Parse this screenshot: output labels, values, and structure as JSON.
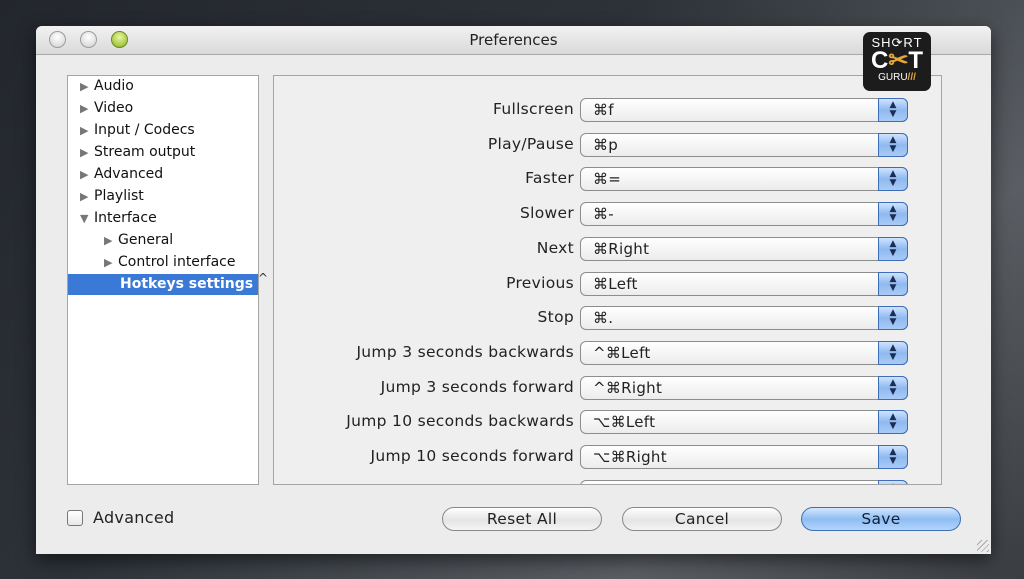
{
  "window": {
    "title": "Preferences"
  },
  "sidebar": {
    "items": [
      {
        "label": "Audio",
        "expanded": false,
        "level": 0
      },
      {
        "label": "Video",
        "expanded": false,
        "level": 0
      },
      {
        "label": "Input / Codecs",
        "expanded": false,
        "level": 0
      },
      {
        "label": "Stream output",
        "expanded": false,
        "level": 0
      },
      {
        "label": "Advanced",
        "expanded": false,
        "level": 0
      },
      {
        "label": "Playlist",
        "expanded": false,
        "level": 0
      },
      {
        "label": "Interface",
        "expanded": true,
        "level": 0
      },
      {
        "label": "General",
        "expanded": false,
        "level": 1
      },
      {
        "label": "Control interface",
        "expanded": false,
        "level": 1
      },
      {
        "label": "Hotkeys settings",
        "selected": true,
        "level": 1
      }
    ]
  },
  "hotkeys": [
    {
      "label": "Fullscreen",
      "value": "⌘f"
    },
    {
      "label": "Play/Pause",
      "value": "⌘p"
    },
    {
      "label": "Faster",
      "value": "⌘="
    },
    {
      "label": "Slower",
      "value": "⌘-"
    },
    {
      "label": "Next",
      "value": "⌘Right"
    },
    {
      "label": "Previous",
      "value": "⌘Left"
    },
    {
      "label": "Stop",
      "value": "⌘."
    },
    {
      "label": "Jump 3 seconds backwards",
      "value": "^⌘Left"
    },
    {
      "label": "Jump 3 seconds forward",
      "value": "^⌘Right"
    },
    {
      "label": "Jump 10 seconds backwards",
      "value": "⌥⌘Left"
    },
    {
      "label": "Jump 10 seconds forward",
      "value": "⌥⌘Right"
    }
  ],
  "footer": {
    "advanced_label": "Advanced",
    "advanced_checked": false,
    "reset_label": "Reset All",
    "cancel_label": "Cancel",
    "save_label": "Save"
  },
  "icons": {
    "expanded": "▼",
    "collapsed": "▶",
    "updown": "▲▼",
    "caret": "^"
  },
  "logo": {
    "line1": "SH⟳RT",
    "line2a": "C",
    "line2b": "✂",
    "line2c": "T",
    "line3": "GURU",
    "line3b": "///"
  },
  "colors": {
    "accent": "#3a7ad6",
    "logo_accent": "#e3a63a"
  }
}
